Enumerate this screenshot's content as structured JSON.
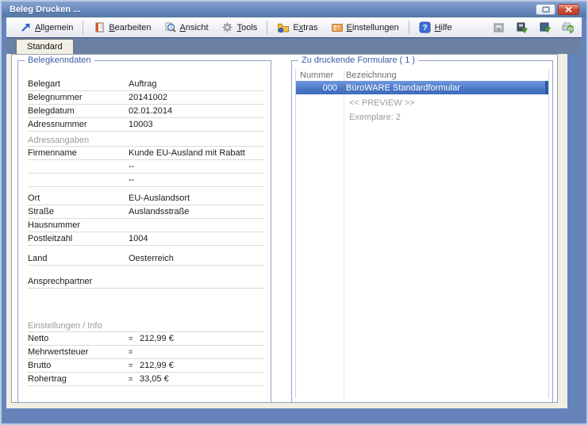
{
  "window": {
    "title": "Beleg Drucken ...",
    "buttons": [
      {
        "name": "restore-button",
        "icon": "restore-icon"
      },
      {
        "name": "close-button",
        "icon": "close-icon"
      }
    ]
  },
  "menu": {
    "groups": [
      [
        {
          "label": "Allgemein",
          "hotkey_index": 0,
          "icon": "diagonal-arrow-icon"
        }
      ],
      [
        {
          "label": "Bearbeiten",
          "hotkey_index": 0,
          "icon": "edit-notebook-icon"
        },
        {
          "label": "Ansicht",
          "hotkey_index": 0,
          "icon": "magnifier-icon"
        },
        {
          "label": "Tools",
          "hotkey_index": 0,
          "icon": "gear-icon"
        }
      ],
      [
        {
          "label": "Extras",
          "hotkey_index": 1,
          "icon": "folder-icon"
        },
        {
          "label": "Einstellungen",
          "hotkey_index": 0,
          "icon": "settings-panel-icon"
        }
      ],
      [
        {
          "label": "Hilfe",
          "hotkey_index": 0,
          "icon": "help-icon"
        }
      ]
    ]
  },
  "toolbar_right": {
    "icons": [
      "archive-icon",
      "export-document-icon",
      "import-document-icon",
      "print-refresh-icon"
    ]
  },
  "tabs": [
    {
      "label": "Standard",
      "active": true
    }
  ],
  "left_panel": {
    "title": "Belegkenndaten",
    "rows": [
      {
        "t": "f",
        "label": "Belegart",
        "value": "Auftrag"
      },
      {
        "t": "f",
        "label": "Belegnummer",
        "value": "20141002"
      },
      {
        "t": "f",
        "label": "Belegdatum",
        "value": "02.01.2014"
      },
      {
        "t": "f",
        "label": "Adressnummer",
        "value": "10003"
      },
      {
        "t": "gap",
        "h": 4
      },
      {
        "t": "s",
        "label": "Adressangaben"
      },
      {
        "t": "f",
        "label": "Firmenname",
        "value": "Kunde EU-Ausland mit Rabatt"
      },
      {
        "t": "f",
        "label": "",
        "value": "--"
      },
      {
        "t": "f",
        "label": "",
        "value": "--"
      },
      {
        "t": "gap",
        "h": 6
      },
      {
        "t": "f",
        "label": "Ort",
        "value": "EU-Auslandsort"
      },
      {
        "t": "f",
        "label": "Straße",
        "value": "Auslandsstraße"
      },
      {
        "t": "f",
        "label": "Hausnummer",
        "value": ""
      },
      {
        "t": "f",
        "label": "Postleitzahl",
        "value": "1004"
      },
      {
        "t": "gap",
        "h": 8
      },
      {
        "t": "f",
        "label": "Land",
        "value": "Oesterreich"
      },
      {
        "t": "gap",
        "h": 12
      },
      {
        "t": "f",
        "label": "Ansprechpartner",
        "value": ""
      },
      {
        "t": "gap",
        "h": 40
      },
      {
        "t": "s",
        "label": "Einstellungen / Info"
      },
      {
        "t": "f",
        "label": "Netto",
        "value": "212,99 €",
        "eq": true
      },
      {
        "t": "f",
        "label": "Mehrwertsteuer",
        "value": "",
        "eq": true
      },
      {
        "t": "f",
        "label": "Brutto",
        "value": "212,99 €",
        "eq": true
      },
      {
        "t": "f",
        "label": "Rohertrag",
        "value": "33,05 €",
        "eq": true
      }
    ]
  },
  "right_panel": {
    "title": "Zu druckende Formulare ( 1 )",
    "columns": [
      "Nummer",
      "Bezeichnung"
    ],
    "rows": [
      {
        "nummer": "000",
        "bezeichnung": "BüroWARE Standardformular",
        "selected": true
      }
    ],
    "notes": [
      "<< PREVIEW >>",
      "Exemplare: 2"
    ]
  },
  "colors": {
    "titlebar": "#6286bd",
    "frame": "#6584ba",
    "tab_strip": "#6a81a4",
    "content_bg": "#f1efe3",
    "accent_text": "#3a5ca8",
    "section_text": "#9b9b9b",
    "selection_top": "#6f98de",
    "selection_bottom": "#3e6cba",
    "close_button": "#c23b24"
  }
}
